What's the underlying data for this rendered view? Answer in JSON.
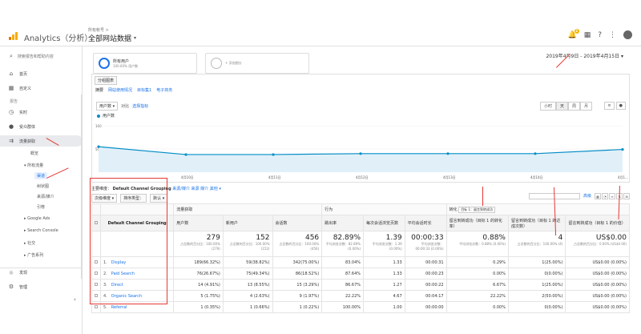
{
  "topbar": {
    "app_name": "Analytics（分析）",
    "breadcrumb": "所有帐号 >",
    "view_name": "全部网站数据",
    "notif_count": "2",
    "colors": {
      "accent": "#1a73e8",
      "logo": "#f9ab00",
      "annotation": "#e53935"
    }
  },
  "sidebar": {
    "search_placeholder": "搜索报告和帮助内容",
    "items": [
      {
        "label": "首页",
        "icon": "home-icon"
      },
      {
        "label": "自定义",
        "icon": "grid-icon"
      },
      {
        "label": "报告",
        "section": true
      },
      {
        "label": "实时",
        "icon": "clock-icon"
      },
      {
        "label": "受众群体",
        "icon": "person-icon"
      },
      {
        "label": "流量获取",
        "icon": "acquisition-icon",
        "active": true
      }
    ],
    "sub_items": {
      "overview": "概览",
      "all_traffic": "▾ 所有流量",
      "channels": "渠道",
      "treemap": "树状图",
      "source_medium": "来源/媒介",
      "referrals": "引荐",
      "google_ads": "▸ Google Ads",
      "search_console": "▸ Search Console",
      "social": "▸ 社交",
      "campaigns": "▸ 广告系列"
    },
    "discover": "发现",
    "admin": "管理"
  },
  "segments": {
    "seg1_title": "所有用户",
    "seg1_sub": "100.00% 用户数",
    "seg2_title": "+ 添加细分"
  },
  "date_range": "2019年4月9日 - 2019年4月15日 ▾",
  "explorer": {
    "tab": "分组图表",
    "subtabs": [
      "摘要",
      "网站使用情况",
      "目标集1",
      "电子商务"
    ],
    "metric": "用户数 ▾",
    "vs": "对比",
    "select_metric": "选择指标",
    "intervals": [
      "小时",
      "天",
      "周",
      "月"
    ],
    "charttypes": [
      "≡",
      "●"
    ],
    "legend": "用户数"
  },
  "chart_data": {
    "type": "line",
    "x": [
      "4月9日",
      "4月10日",
      "4月11日",
      "4月12日",
      "4月13日",
      "4月14日",
      "4月15日"
    ],
    "x_tick_labels": [
      "4月10日",
      "4月11日",
      "4月12日",
      "4月13日",
      "4月14日",
      "4月1..."
    ],
    "series": [
      {
        "name": "用户数",
        "values": [
          55,
          38,
          38,
          40,
          40,
          40,
          49
        ]
      }
    ],
    "y_ticks": [
      "100",
      "50"
    ],
    "ylim": [
      0,
      100
    ],
    "color": "#058dc7"
  },
  "table": {
    "dim_label": "主要维度：",
    "dim_value": "Default Channel Grouping",
    "dim_links": [
      "来源/媒介",
      "来源",
      "媒介",
      "其他 ▾"
    ],
    "tools": [
      "次级维度 ▾",
      "排序类型：",
      "默认 ▾"
    ],
    "advanced": "高级",
    "group_headers": [
      "流量获取",
      "行为",
      "转化",
      "目标 1：留言到转成功"
    ],
    "dim_header": "Default Channel Grouping",
    "col_headers": [
      "用户数",
      "新用户",
      "会话数",
      "跳出率",
      "每次会话浏览页数",
      "平均会话时长",
      "留言到转成功（目标 1 的转化率）",
      "留言到转成功（目标 1 的达成次数）",
      "留言到转成功（目标 1 的价值）"
    ],
    "totals": [
      {
        "big": "279",
        "small": "占总数的百分比：100.00% (279)"
      },
      {
        "big": "152",
        "small": "占总数的百分比：100.00% (152)"
      },
      {
        "big": "456",
        "small": "占总数的百分比：100.00% (456)"
      },
      {
        "big": "82.89%",
        "small": "平均浏览次数：82.89% (0.00%)"
      },
      {
        "big": "1.39",
        "small": "平均浏览次数：1.39 (0.00%)"
      },
      {
        "big": "00:00:33",
        "small": "平均浏览次数：00:00:33 (0.00%)"
      },
      {
        "big": "0.88%",
        "small": "平均浏览次数：0.88% (0.00%)"
      },
      {
        "big": "4",
        "small": "占总数的百分比：100.00% (4)"
      },
      {
        "big": "US$0.00",
        "small": "占总数的百分比：0.00% (US$0.00)"
      }
    ],
    "rows": [
      {
        "idx": "1.",
        "name": "Display",
        "c": [
          "189(66.32%)",
          "59(38.82%)",
          "342(75.00%)",
          "83.04%",
          "1.33",
          "00:00:31",
          "0.29%",
          "1(25.00%)",
          "US$0.00 (0.00%)"
        ]
      },
      {
        "idx": "2.",
        "name": "Paid Search",
        "c": [
          "76(26.67%)",
          "75(49.34%)",
          "86(18.52%)",
          "87.64%",
          "1.33",
          "00:00:23",
          "0.00%",
          "0(0.00%)",
          "US$0.00 (0.00%)"
        ]
      },
      {
        "idx": "3.",
        "name": "Direct",
        "c": [
          "14 (4.91%)",
          "13 (8.55%)",
          "15 (3.29%)",
          "86.67%",
          "1.27",
          "00:00:22",
          "6.67%",
          "1(25.00%)",
          "US$0.00 (0.00%)"
        ]
      },
      {
        "idx": "4.",
        "name": "Organic Search",
        "c": [
          "5 (1.75%)",
          "4 (2.63%)",
          "9 (1.97%)",
          "22.22%",
          "4.67",
          "00:04:17",
          "22.22%",
          "2(50.00%)",
          "US$0.00 (0.00%)"
        ]
      },
      {
        "idx": "5.",
        "name": "Referral",
        "c": [
          "1 (0.35%)",
          "1 (0.66%)",
          "1 (0.22%)",
          "100.00%",
          "1.00",
          "00:00:00",
          "0.00%",
          "0(0.00%)",
          "US$0.00 (0.00%)"
        ]
      }
    ]
  }
}
